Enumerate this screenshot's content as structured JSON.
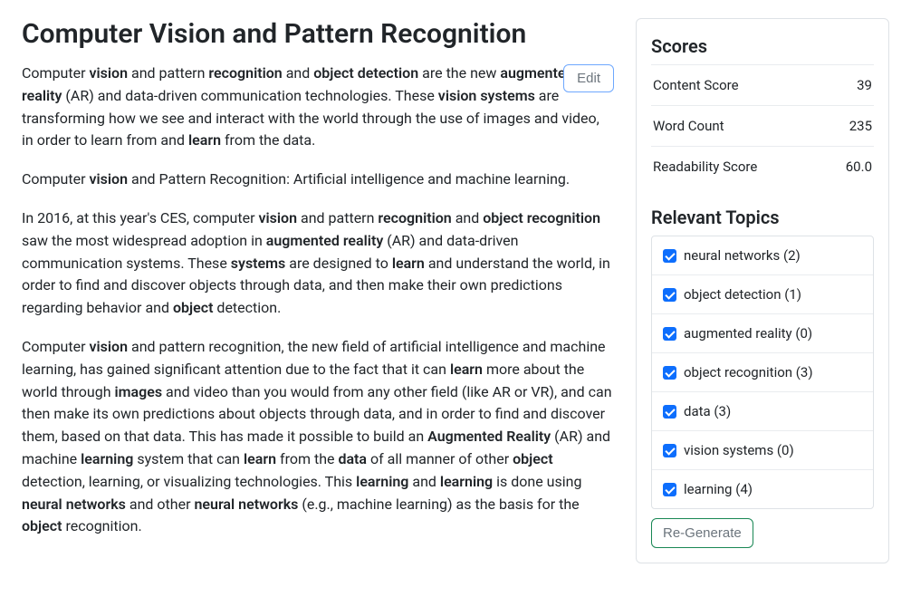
{
  "title": "Computer Vision and Pattern Recognition",
  "edit_label": "Edit",
  "article": {
    "p1_html": "Computer <strong>vision</strong> and pattern <strong>recognition</strong> and <strong>object detection</strong> are the new <strong>augmented reality</strong> (AR) and data-driven communication technologies. These <strong>vision systems</strong> are transforming how we see and interact with the world through the use of images and video, in order to learn from and <strong>learn</strong> from the data.",
    "p2_html": "Computer <strong>vision</strong> and Pattern Recognition: Artificial intelligence and machine learning.",
    "p3_html": "In 2016, at this year's CES, computer <strong>vision</strong> and pattern <strong>recognition</strong> and <strong>object recognition</strong> saw the most widespread adoption in <strong>augmented reality</strong> (AR) and data-driven communication systems. These <strong>systems</strong> are designed to <strong>learn</strong> and understand the world, in order to find and discover objects through data, and then make their own predictions regarding behavior and <strong>object</strong> detection.",
    "p4_html": "Computer <strong>vision</strong> and pattern recognition, the new field of artificial intelligence and machine learning, has gained significant attention due to the fact that it can <strong>learn</strong> more about the world through <strong>images</strong> and video than you would from any other field (like AR or VR), and can then make its own predictions about objects through data, and in order to find and discover them, based on that data. This has made it possible to build an <strong>Augmented Reality</strong> (AR) and machine <strong>learning</strong> system that can <strong>learn</strong> from the <strong>data</strong> of all manner of other <strong>object</strong> detection, learning, or visualizing technologies. This <strong>learning</strong> and <strong>learning</strong> is done using <strong>neural networks</strong> and other <strong>neural networks</strong> (e.g., machine learning) as the basis for the <strong>object</strong> recognition."
  },
  "side": {
    "scores_heading": "Scores",
    "scores": [
      {
        "label": "Content Score",
        "value": "39"
      },
      {
        "label": "Word Count",
        "value": "235"
      },
      {
        "label": "Readability Score",
        "value": "60.0"
      }
    ],
    "topics_heading": "Relevant Topics",
    "topics": [
      {
        "label": "neural networks (2)",
        "checked": true
      },
      {
        "label": "object detection (1)",
        "checked": true
      },
      {
        "label": "augmented reality (0)",
        "checked": true
      },
      {
        "label": "object recognition (3)",
        "checked": true
      },
      {
        "label": "data (3)",
        "checked": true
      },
      {
        "label": "vision systems (0)",
        "checked": true
      },
      {
        "label": "learning (4)",
        "checked": true
      }
    ],
    "regenerate_label": "Re-Generate"
  }
}
